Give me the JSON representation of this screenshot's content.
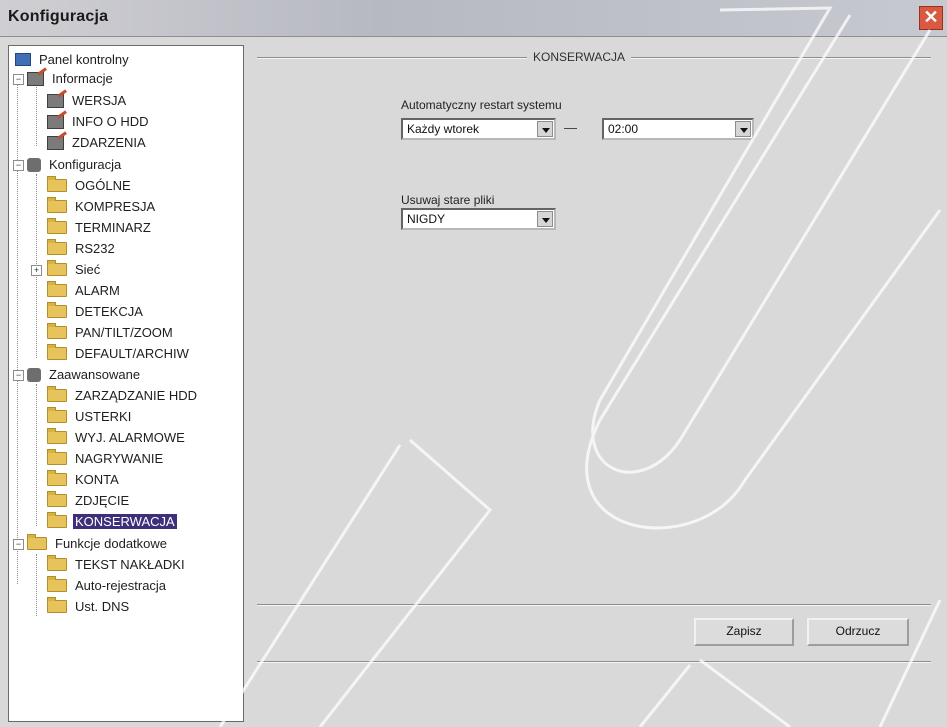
{
  "window": {
    "title": "Konfiguracja",
    "close_glyph": "✕"
  },
  "tree": {
    "panel": "Panel kontrolny",
    "informacje": {
      "label": "Informacje",
      "items": [
        "WERSJA",
        "INFO O HDD",
        "ZDARZENIA"
      ]
    },
    "konfiguracja": {
      "label": "Konfiguracja",
      "items": [
        "OGÓLNE",
        "KOMPRESJA",
        "TERMINARZ",
        "RS232",
        "Sieć",
        "ALARM",
        "DETEKCJA",
        "PAN/TILT/ZOOM",
        "DEFAULT/ARCHIW"
      ]
    },
    "zaawansowane": {
      "label": "Zaawansowane",
      "items": [
        "ZARZĄDZANIE HDD",
        "USTERKI",
        "WYJ. ALARMOWE",
        "NAGRYWANIE",
        "KONTA",
        "ZDJĘCIE",
        "KONSERWACJA"
      ]
    },
    "funkcje": {
      "label": "Funkcje dodatkowe",
      "items": [
        "TEKST NAKŁADKI",
        "Auto-rejestracja",
        "Ust. DNS"
      ]
    },
    "selected": "KONSERWACJA"
  },
  "content": {
    "section_title": "KONSERWACJA",
    "restart_label": "Automatyczny restart systemu",
    "restart_day": "Każdy wtorek",
    "restart_time": "02:00",
    "delete_label": "Usuwaj stare pliki",
    "delete_value": "NIGDY",
    "save_label": "Zapisz",
    "cancel_label": "Odrzucz"
  }
}
